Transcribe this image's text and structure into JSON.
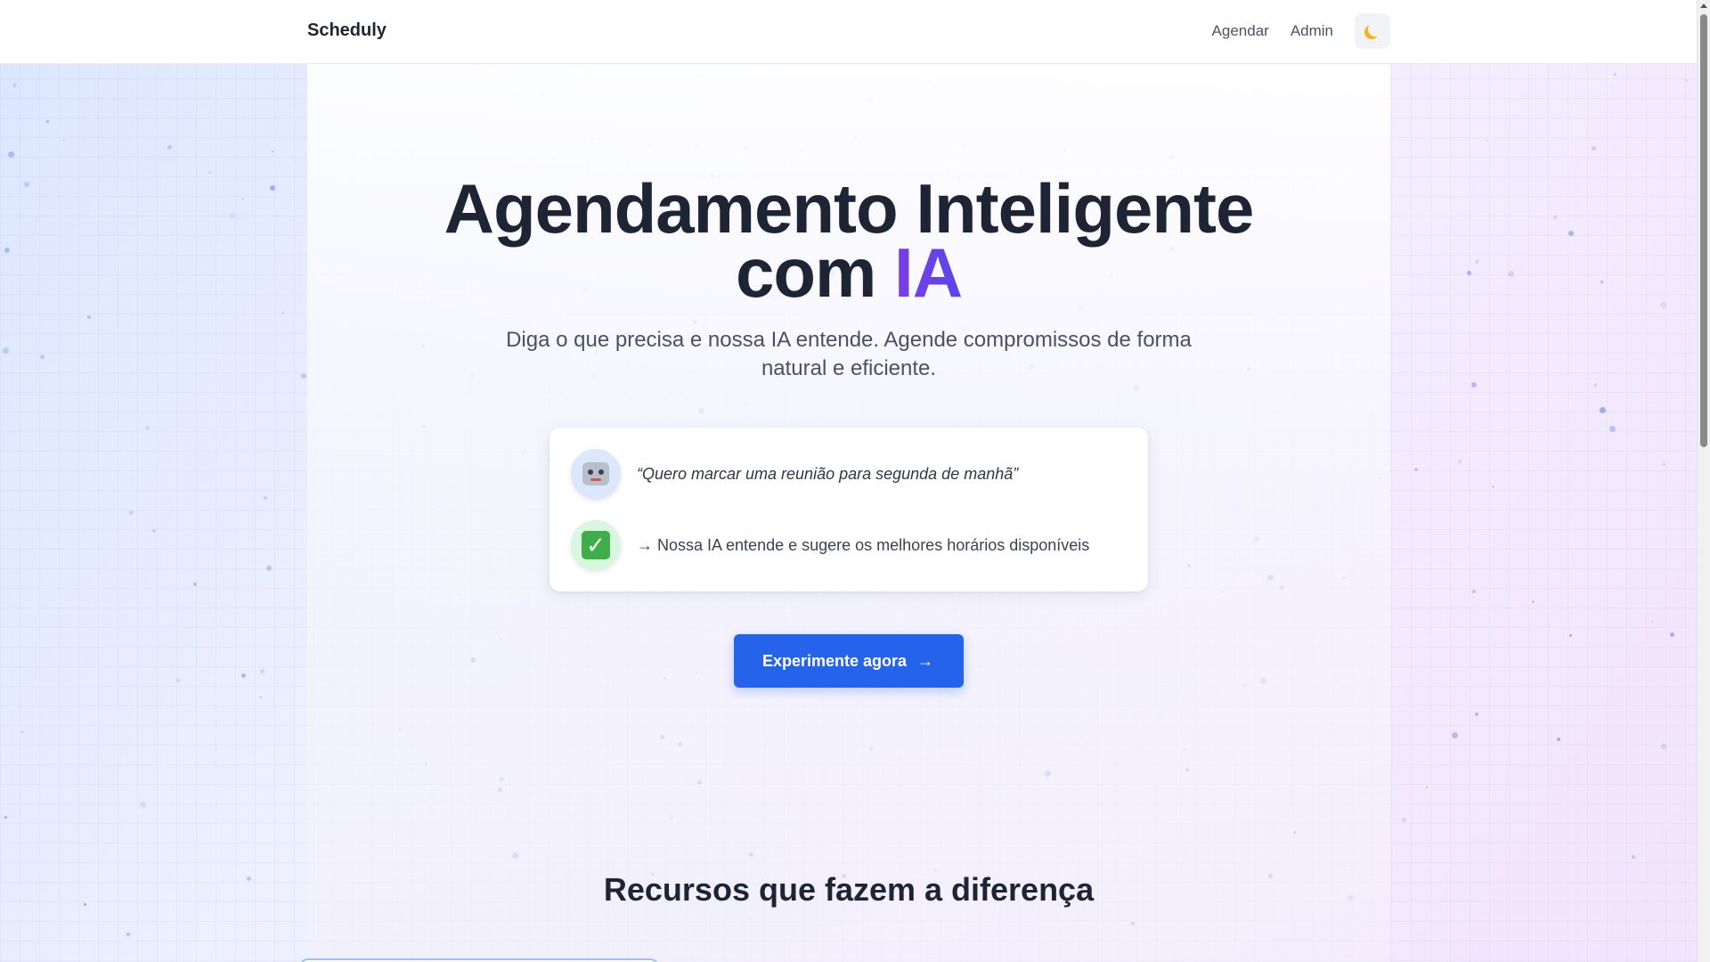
{
  "header": {
    "brand": "Scheduly",
    "nav": [
      {
        "label": "Agendar"
      },
      {
        "label": "Admin"
      }
    ],
    "theme_toggle_icon": "moon-icon"
  },
  "hero": {
    "title_line1": "Agendamento Inteligente",
    "title_line2_prefix": "com ",
    "title_accent": "IA",
    "subtitle": "Diga o que precisa e nossa IA entende. Agende compromissos de forma natural e eficiente.",
    "example": {
      "quote": "“Quero marcar uma reunião para segunda de manhã”",
      "quote_icon": "robot-icon",
      "answer": "→ Nossa IA entende e sugere os melhores horários disponíveis",
      "answer_icon": "check-mark-icon"
    },
    "cta_label": "Experimente agora",
    "cta_arrow": "→"
  },
  "features": {
    "title": "Recursos que fazem a diferença"
  },
  "colors": {
    "primary": "#2563eb",
    "accent": "#7a3ee6",
    "text_dark": "#1d2433"
  }
}
